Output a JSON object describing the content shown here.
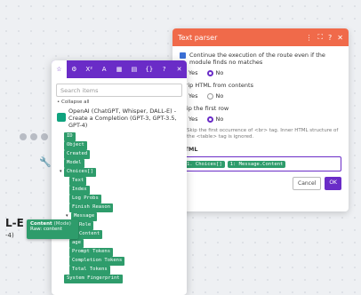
{
  "canvas": {
    "node_letter": "L-E",
    "node_sub": "-4)"
  },
  "text_parser": {
    "title": "Text parser",
    "header_icons": [
      "⋮",
      "⛶",
      "?",
      "✕"
    ],
    "option1_label": "Continue the execution of the route even if the module finds no matches",
    "option1_yes": "Yes",
    "option1_no": "No",
    "option2_label": "Strip HTML from contents",
    "option2_yes": "Yes",
    "option2_no": "No",
    "option3_label": "Skip the first row",
    "option3_yes": "Yes",
    "option3_no": "No",
    "option3_hint": "Skip the first occurrence of <br> tag. Inner HTML structure of the <table> tag is ignored.",
    "html_label": "HTML",
    "html_value_part1": "1. Choices[]",
    "html_value_part2": "1: Message.Content",
    "cancel_label": "Cancel",
    "ok_label": "OK"
  },
  "mapping_panel": {
    "tabs": [
      "☆",
      "⚙",
      "X²",
      "A",
      "▦",
      "▤",
      "{}"
    ],
    "extra_icons": [
      "?",
      "✕"
    ],
    "search_placeholder": "Search items",
    "collapse_label": "• Collapse all",
    "module_name": "OpenAI (ChatGPT, Whisper, DALL-E) - Create a Completion (GPT-3, GPT-3.5, GPT-4)",
    "items": {
      "id": "ID",
      "object": "Object",
      "created": "Created",
      "model": "Model",
      "choices": "Choices[]",
      "text": "Text",
      "index": "Index",
      "logprobs": "Log Probs",
      "finish": "Finish Reason",
      "message": "Message",
      "role": "Role",
      "content": "Content",
      "usage": "age",
      "prompt": "Prompt Tokens",
      "completion": "Completion Tokens",
      "total": "Total Tokens",
      "fingerprint": "System Fingerprint"
    }
  },
  "tooltip": {
    "title": "Content",
    "type": "(Mode)",
    "subtitle": "Raw: content"
  }
}
